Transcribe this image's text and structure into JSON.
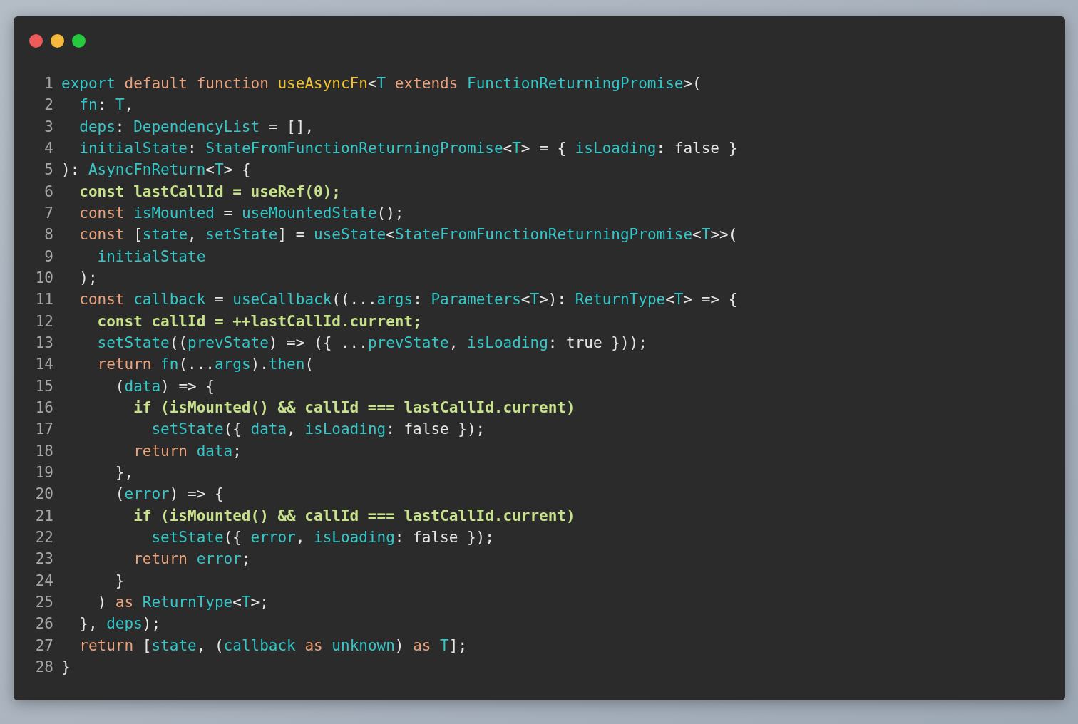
{
  "window": {
    "controls": [
      {
        "kind": "close"
      },
      {
        "kind": "minimize"
      },
      {
        "kind": "zoom"
      }
    ]
  },
  "code_lines": [
    {
      "number": "1",
      "tokens": [
        {
          "text": "export ",
          "kind": "name"
        },
        {
          "text": "default function ",
          "kind": "keyword"
        },
        {
          "text": "useAsyncFn",
          "kind": "function"
        },
        {
          "text": "<",
          "kind": "plain"
        },
        {
          "text": "T ",
          "kind": "name"
        },
        {
          "text": "extends ",
          "kind": "keyword"
        },
        {
          "text": "FunctionReturningPromise",
          "kind": "name"
        },
        {
          "text": ">(",
          "kind": "plain"
        }
      ]
    },
    {
      "number": "2",
      "tokens": [
        {
          "text": "  fn",
          "kind": "name"
        },
        {
          "text": ": ",
          "kind": "plain"
        },
        {
          "text": "T",
          "kind": "name"
        },
        {
          "text": ",",
          "kind": "plain"
        }
      ]
    },
    {
      "number": "3",
      "tokens": [
        {
          "text": "  deps",
          "kind": "name"
        },
        {
          "text": ": ",
          "kind": "plain"
        },
        {
          "text": "DependencyList",
          "kind": "name"
        },
        {
          "text": " = [],",
          "kind": "plain"
        }
      ]
    },
    {
      "number": "4",
      "tokens": [
        {
          "text": "  initialState",
          "kind": "name"
        },
        {
          "text": ": ",
          "kind": "plain"
        },
        {
          "text": "StateFromFunctionReturningPromise",
          "kind": "name"
        },
        {
          "text": "<",
          "kind": "plain"
        },
        {
          "text": "T",
          "kind": "name"
        },
        {
          "text": "> = { ",
          "kind": "plain"
        },
        {
          "text": "isLoading",
          "kind": "name"
        },
        {
          "text": ": false }",
          "kind": "plain"
        }
      ]
    },
    {
      "number": "5",
      "tokens": [
        {
          "text": "): ",
          "kind": "plain"
        },
        {
          "text": "AsyncFnReturn",
          "kind": "name"
        },
        {
          "text": "<",
          "kind": "plain"
        },
        {
          "text": "T",
          "kind": "name"
        },
        {
          "text": "> {",
          "kind": "plain"
        }
      ]
    },
    {
      "number": "6",
      "tokens": [
        {
          "text": "  const lastCallId = useRef(0);",
          "kind": "highlight"
        }
      ]
    },
    {
      "number": "7",
      "tokens": [
        {
          "text": "  const ",
          "kind": "keyword"
        },
        {
          "text": "isMounted",
          "kind": "name"
        },
        {
          "text": " = ",
          "kind": "plain"
        },
        {
          "text": "useMountedState",
          "kind": "name"
        },
        {
          "text": "();",
          "kind": "plain"
        }
      ]
    },
    {
      "number": "8",
      "tokens": [
        {
          "text": "  const",
          "kind": "keyword"
        },
        {
          "text": " [",
          "kind": "plain"
        },
        {
          "text": "state",
          "kind": "name"
        },
        {
          "text": ", ",
          "kind": "plain"
        },
        {
          "text": "setState",
          "kind": "name"
        },
        {
          "text": "] = ",
          "kind": "plain"
        },
        {
          "text": "useState",
          "kind": "name"
        },
        {
          "text": "<",
          "kind": "plain"
        },
        {
          "text": "StateFromFunctionReturningPromise",
          "kind": "name"
        },
        {
          "text": "<",
          "kind": "plain"
        },
        {
          "text": "T",
          "kind": "name"
        },
        {
          "text": ">>(",
          "kind": "plain"
        }
      ]
    },
    {
      "number": "9",
      "tokens": [
        {
          "text": "    initialState",
          "kind": "name"
        }
      ]
    },
    {
      "number": "10",
      "tokens": [
        {
          "text": "  );",
          "kind": "plain"
        }
      ]
    },
    {
      "number": "11",
      "tokens": [
        {
          "text": "  const ",
          "kind": "keyword"
        },
        {
          "text": "callback",
          "kind": "name"
        },
        {
          "text": " = ",
          "kind": "plain"
        },
        {
          "text": "useCallback",
          "kind": "name"
        },
        {
          "text": "((...",
          "kind": "plain"
        },
        {
          "text": "args",
          "kind": "name"
        },
        {
          "text": ": ",
          "kind": "plain"
        },
        {
          "text": "Parameters",
          "kind": "name"
        },
        {
          "text": "<",
          "kind": "plain"
        },
        {
          "text": "T",
          "kind": "name"
        },
        {
          "text": ">): ",
          "kind": "plain"
        },
        {
          "text": "ReturnType",
          "kind": "name"
        },
        {
          "text": "<",
          "kind": "plain"
        },
        {
          "text": "T",
          "kind": "name"
        },
        {
          "text": "> => {",
          "kind": "plain"
        }
      ]
    },
    {
      "number": "12",
      "tokens": [
        {
          "text": "    const callId = ++lastCallId.current;",
          "kind": "highlight"
        }
      ]
    },
    {
      "number": "13",
      "tokens": [
        {
          "text": "    setState",
          "kind": "name"
        },
        {
          "text": "((",
          "kind": "plain"
        },
        {
          "text": "prevState",
          "kind": "name"
        },
        {
          "text": ") => ({ ...",
          "kind": "plain"
        },
        {
          "text": "prevState",
          "kind": "name"
        },
        {
          "text": ", ",
          "kind": "plain"
        },
        {
          "text": "isLoading",
          "kind": "name"
        },
        {
          "text": ": true }));",
          "kind": "plain"
        }
      ]
    },
    {
      "number": "14",
      "tokens": [
        {
          "text": "    return ",
          "kind": "keyword"
        },
        {
          "text": "fn",
          "kind": "name"
        },
        {
          "text": "(...",
          "kind": "plain"
        },
        {
          "text": "args",
          "kind": "name"
        },
        {
          "text": ").",
          "kind": "plain"
        },
        {
          "text": "then",
          "kind": "name"
        },
        {
          "text": "(",
          "kind": "plain"
        }
      ]
    },
    {
      "number": "15",
      "tokens": [
        {
          "text": "      (",
          "kind": "plain"
        },
        {
          "text": "data",
          "kind": "name"
        },
        {
          "text": ") => {",
          "kind": "plain"
        }
      ]
    },
    {
      "number": "16",
      "tokens": [
        {
          "text": "        if (isMounted() && callId === lastCallId.current)",
          "kind": "highlight"
        }
      ]
    },
    {
      "number": "17",
      "tokens": [
        {
          "text": "          setState",
          "kind": "name"
        },
        {
          "text": "({ ",
          "kind": "plain"
        },
        {
          "text": "data",
          "kind": "name"
        },
        {
          "text": ", ",
          "kind": "plain"
        },
        {
          "text": "isLoading",
          "kind": "name"
        },
        {
          "text": ": false });",
          "kind": "plain"
        }
      ]
    },
    {
      "number": "18",
      "tokens": [
        {
          "text": "        return ",
          "kind": "keyword"
        },
        {
          "text": "data",
          "kind": "name"
        },
        {
          "text": ";",
          "kind": "plain"
        }
      ]
    },
    {
      "number": "19",
      "tokens": [
        {
          "text": "      },",
          "kind": "plain"
        }
      ]
    },
    {
      "number": "20",
      "tokens": [
        {
          "text": "      (",
          "kind": "plain"
        },
        {
          "text": "error",
          "kind": "name"
        },
        {
          "text": ") => {",
          "kind": "plain"
        }
      ]
    },
    {
      "number": "21",
      "tokens": [
        {
          "text": "        if (isMounted() && callId === lastCallId.current)",
          "kind": "highlight"
        }
      ]
    },
    {
      "number": "22",
      "tokens": [
        {
          "text": "          setState",
          "kind": "name"
        },
        {
          "text": "({ ",
          "kind": "plain"
        },
        {
          "text": "error",
          "kind": "name"
        },
        {
          "text": ", ",
          "kind": "plain"
        },
        {
          "text": "isLoading",
          "kind": "name"
        },
        {
          "text": ": false });",
          "kind": "plain"
        }
      ]
    },
    {
      "number": "23",
      "tokens": [
        {
          "text": "        return ",
          "kind": "keyword"
        },
        {
          "text": "error",
          "kind": "name"
        },
        {
          "text": ";",
          "kind": "plain"
        }
      ]
    },
    {
      "number": "24",
      "tokens": [
        {
          "text": "      }",
          "kind": "plain"
        }
      ]
    },
    {
      "number": "25",
      "tokens": [
        {
          "text": "    ) ",
          "kind": "plain"
        },
        {
          "text": "as ",
          "kind": "keyword"
        },
        {
          "text": "ReturnType",
          "kind": "name"
        },
        {
          "text": "<",
          "kind": "plain"
        },
        {
          "text": "T",
          "kind": "name"
        },
        {
          "text": ">;",
          "kind": "plain"
        }
      ]
    },
    {
      "number": "26",
      "tokens": [
        {
          "text": "  }, ",
          "kind": "plain"
        },
        {
          "text": "deps",
          "kind": "name"
        },
        {
          "text": ");",
          "kind": "plain"
        }
      ]
    },
    {
      "number": "27",
      "tokens": [
        {
          "text": "  return",
          "kind": "keyword"
        },
        {
          "text": " [",
          "kind": "plain"
        },
        {
          "text": "state",
          "kind": "name"
        },
        {
          "text": ", (",
          "kind": "plain"
        },
        {
          "text": "callback ",
          "kind": "name"
        },
        {
          "text": "as ",
          "kind": "keyword"
        },
        {
          "text": "unknown",
          "kind": "name"
        },
        {
          "text": ") ",
          "kind": "plain"
        },
        {
          "text": "as ",
          "kind": "keyword"
        },
        {
          "text": "T",
          "kind": "name"
        },
        {
          "text": "];",
          "kind": "plain"
        }
      ]
    },
    {
      "number": "28",
      "tokens": [
        {
          "text": "}",
          "kind": "plain"
        }
      ]
    }
  ]
}
